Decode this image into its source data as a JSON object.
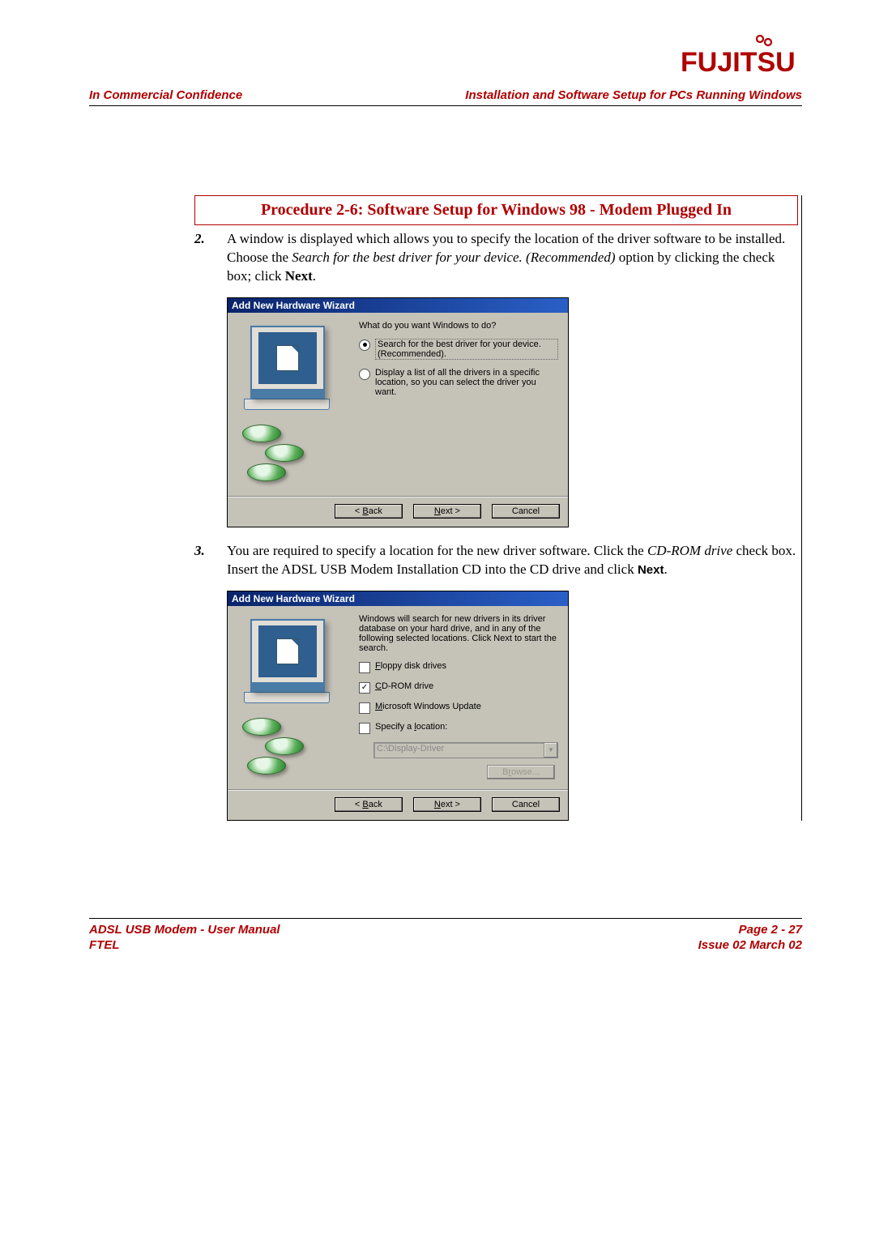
{
  "brand": "FUJITSU",
  "brand_color": "#b00000",
  "header": {
    "left": "In Commercial Confidence",
    "right": "Installation and Software Setup for PCs Running Windows"
  },
  "section_title": "Procedure 2-6: Software Setup for Windows 98 - Modem Plugged In",
  "step2": {
    "num": "2.",
    "t1": "A window is displayed which allows you to specify the location of the driver software to be installed. Choose the ",
    "t2": "Search for the best driver for your device. (Recommended)",
    "t3": " option by clicking the check box; click ",
    "t4": "Next",
    "t5": "."
  },
  "step3": {
    "num": "3.",
    "t1": "You are required to specify a location for the new driver software. Click the ",
    "t2": "CD-ROM drive",
    "t3": " check box. Insert the ADSL USB Modem Installation CD into the CD drive and click ",
    "t4": "Next",
    "t5": "."
  },
  "wizard1": {
    "title": "Add New Hardware Wizard",
    "prompt": "What do you want Windows to do?",
    "opt1a": "Search for the best driver for your device.",
    "opt1b": "(Recommended).",
    "opt2": "Display a list of all the drivers in a specific location, so you can select the driver you want.",
    "back_pre": "< ",
    "back_u": "B",
    "back_post": "ack",
    "next_pre": "",
    "next_u": "N",
    "next_post": "ext >",
    "cancel": "Cancel"
  },
  "wizard2": {
    "title": "Add New Hardware Wizard",
    "intro": "Windows will search for new drivers in its driver database on your hard drive, and in any of the following selected locations. Click Next to start the search.",
    "c1_u": "F",
    "c1_post": "loppy disk drives",
    "c2_u": "C",
    "c2_post": "D-ROM drive",
    "c3_u": "M",
    "c3_post": "icrosoft Windows Update",
    "c4_pre": "Specify a ",
    "c4_u": "l",
    "c4_post": "ocation:",
    "loc_value": "C:\\Display-Driver",
    "browse_pre": "B",
    "browse_u": "r",
    "browse_post": "owse...",
    "back_pre": "< ",
    "back_u": "B",
    "back_post": "ack",
    "next_pre": "",
    "next_u": "N",
    "next_post": "ext >",
    "cancel": "Cancel"
  },
  "footer": {
    "left1": "ADSL USB Modem - User Manual",
    "left2": "FTEL",
    "right1": "Page 2 - 27",
    "right2": "Issue 02 March 02"
  }
}
